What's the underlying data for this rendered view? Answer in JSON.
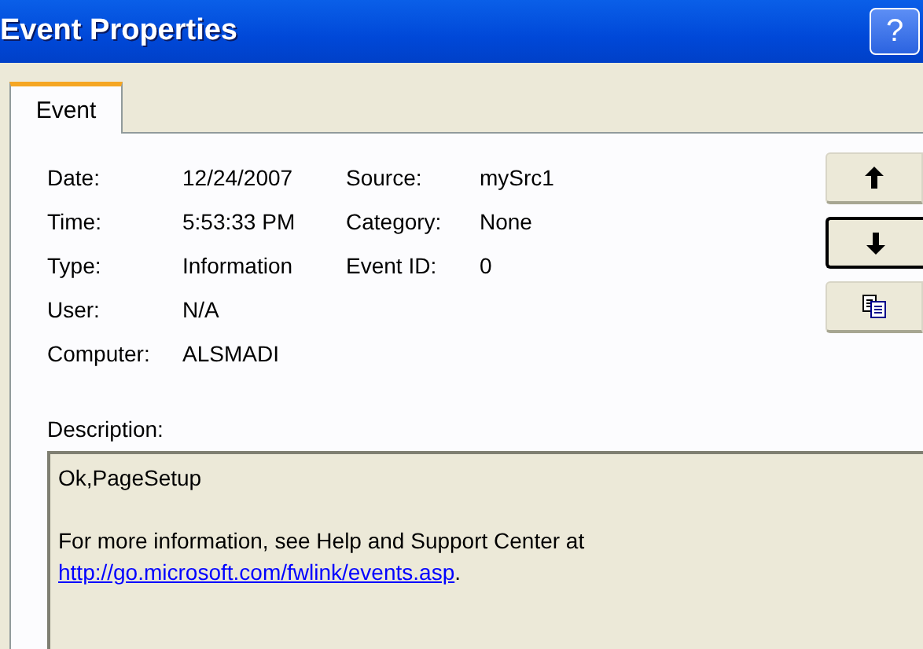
{
  "window": {
    "title": "Event Properties",
    "help": "?"
  },
  "tabs": [
    {
      "label": "Event",
      "selected": true
    }
  ],
  "fields": [
    {
      "label": "Date:",
      "value": "12/24/2007",
      "label2": "Source:",
      "value2": "mySrc1"
    },
    {
      "label": "Time:",
      "value": "5:53:33 PM",
      "label2": "Category:",
      "value2": "None"
    },
    {
      "label": "Type:",
      "value": "Information",
      "label2": "Event ID:",
      "value2": "0"
    },
    {
      "label": "User:",
      "value": "N/A"
    },
    {
      "label": "Computer:",
      "value": "ALSMADI"
    }
  ],
  "buttons": [
    {
      "kind": "up",
      "focused": false
    },
    {
      "kind": "down",
      "focused": true
    },
    {
      "kind": "copy",
      "focused": false
    }
  ],
  "description": {
    "label": "Description:",
    "first_line": "Ok,PageSetup",
    "text": "For more information, see Help and Support Center at",
    "link": "http://go.microsoft.com/fwlink/events.asp",
    "after_link": "."
  }
}
